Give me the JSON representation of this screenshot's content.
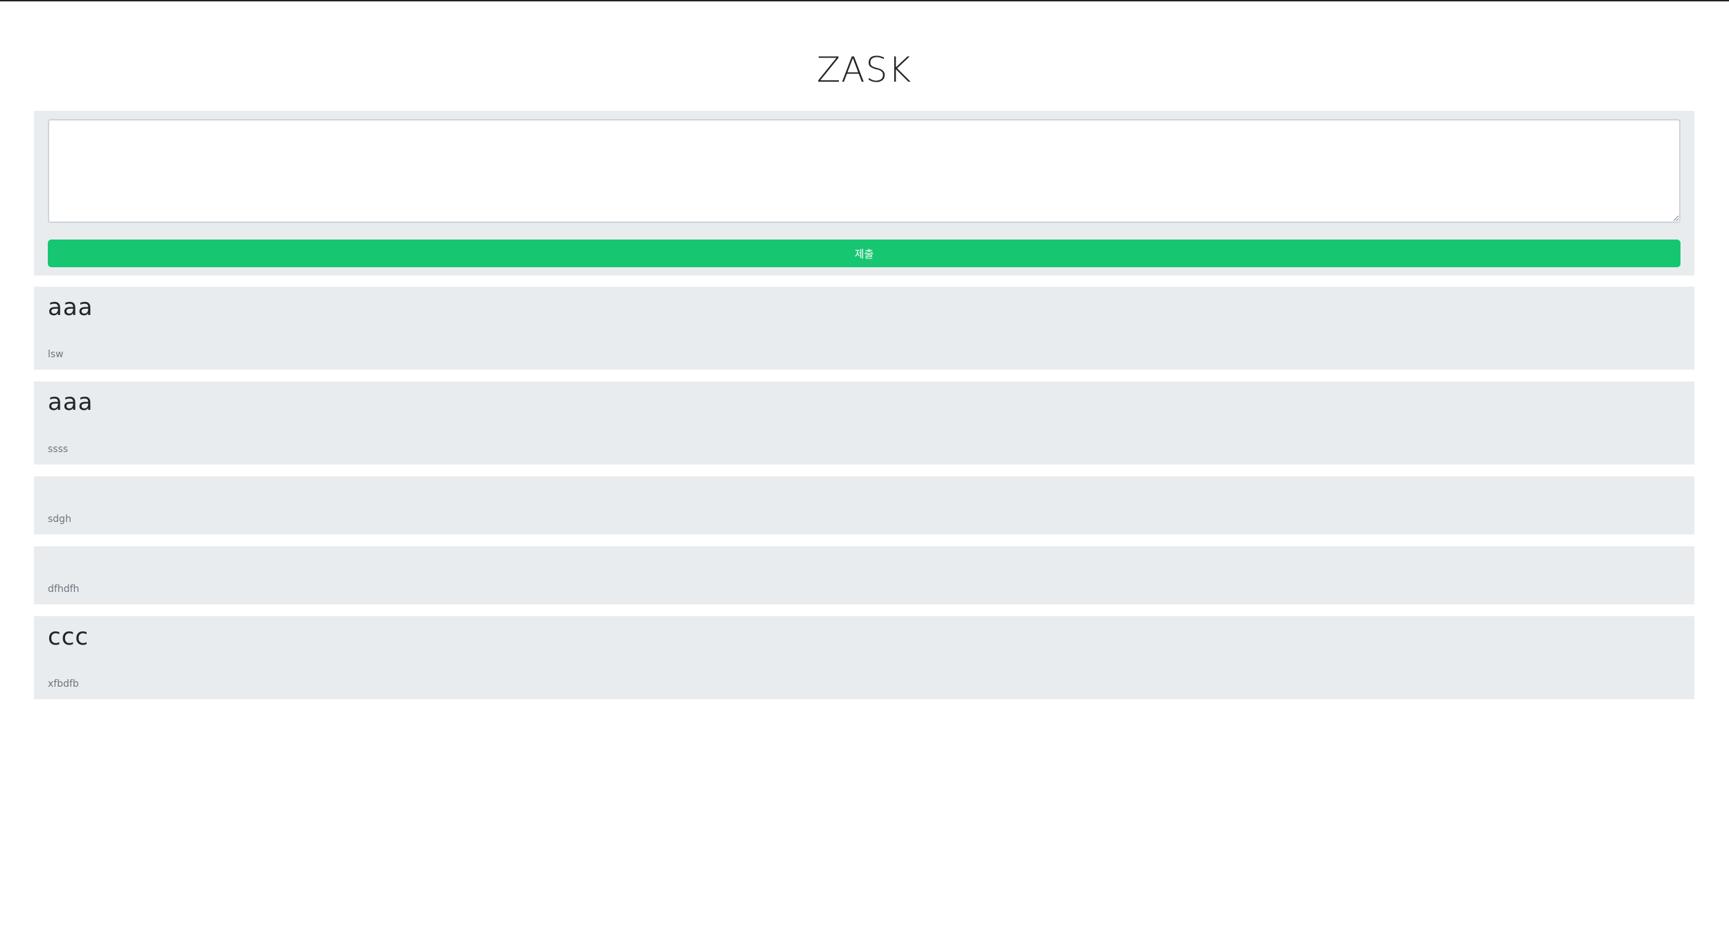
{
  "header": {
    "title": "ZASK"
  },
  "form": {
    "textarea_value": "",
    "submit_label": "제출"
  },
  "posts": [
    {
      "title": "aaa",
      "author": "lsw"
    },
    {
      "title": "aaa",
      "author": "ssss"
    },
    {
      "title": "",
      "author": "sdgh"
    },
    {
      "title": "",
      "author": "dfhdfh"
    },
    {
      "title": "ccc",
      "author": "xfbdfb"
    }
  ],
  "colors": {
    "accent": "#17c671",
    "card_background": "#e9ecef"
  }
}
